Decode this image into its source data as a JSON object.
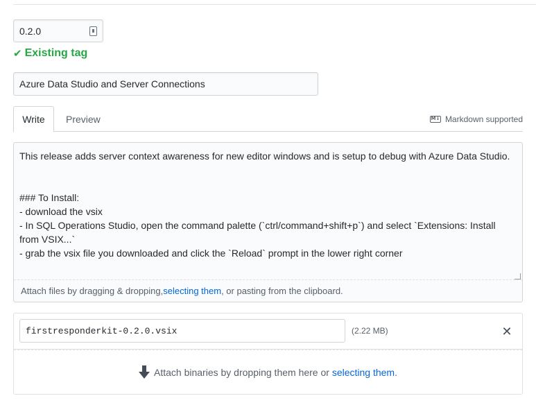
{
  "tag": {
    "value": "0.2.0",
    "status": "Existing tag"
  },
  "release_title": {
    "value": "Azure Data Studio and Server Connections"
  },
  "editor_tabs": {
    "write": "Write",
    "preview": "Preview",
    "markdown_supported": "Markdown supported"
  },
  "editor": {
    "body": "This release adds server context awareness for new editor windows and is setup to debug with Azure Data Studio.\n\n\n### To Install:\n- download the vsix\n- In SQL Operations Studio, open the command palette (`ctrl/command+shift+p`) and select `Extensions: Install from VSIX...`\n- grab the vsix file you downloaded and click the `Reload` prompt in the lower right corner",
    "attach_prefix": "Attach files by dragging & dropping, ",
    "attach_link": "selecting them",
    "attach_suffix": ", or pasting from the clipboard."
  },
  "binaries": {
    "file_name": "firstresponderkit-0.2.0.vsix",
    "file_size": "(2.22 MB)",
    "remove_glyph": "✕",
    "drop_prefix": "Attach binaries by dropping them here or ",
    "drop_link": "selecting them",
    "drop_suffix": "."
  },
  "colors": {
    "success": "#28a745",
    "link": "#0366d6",
    "border": "#d1d5da"
  }
}
